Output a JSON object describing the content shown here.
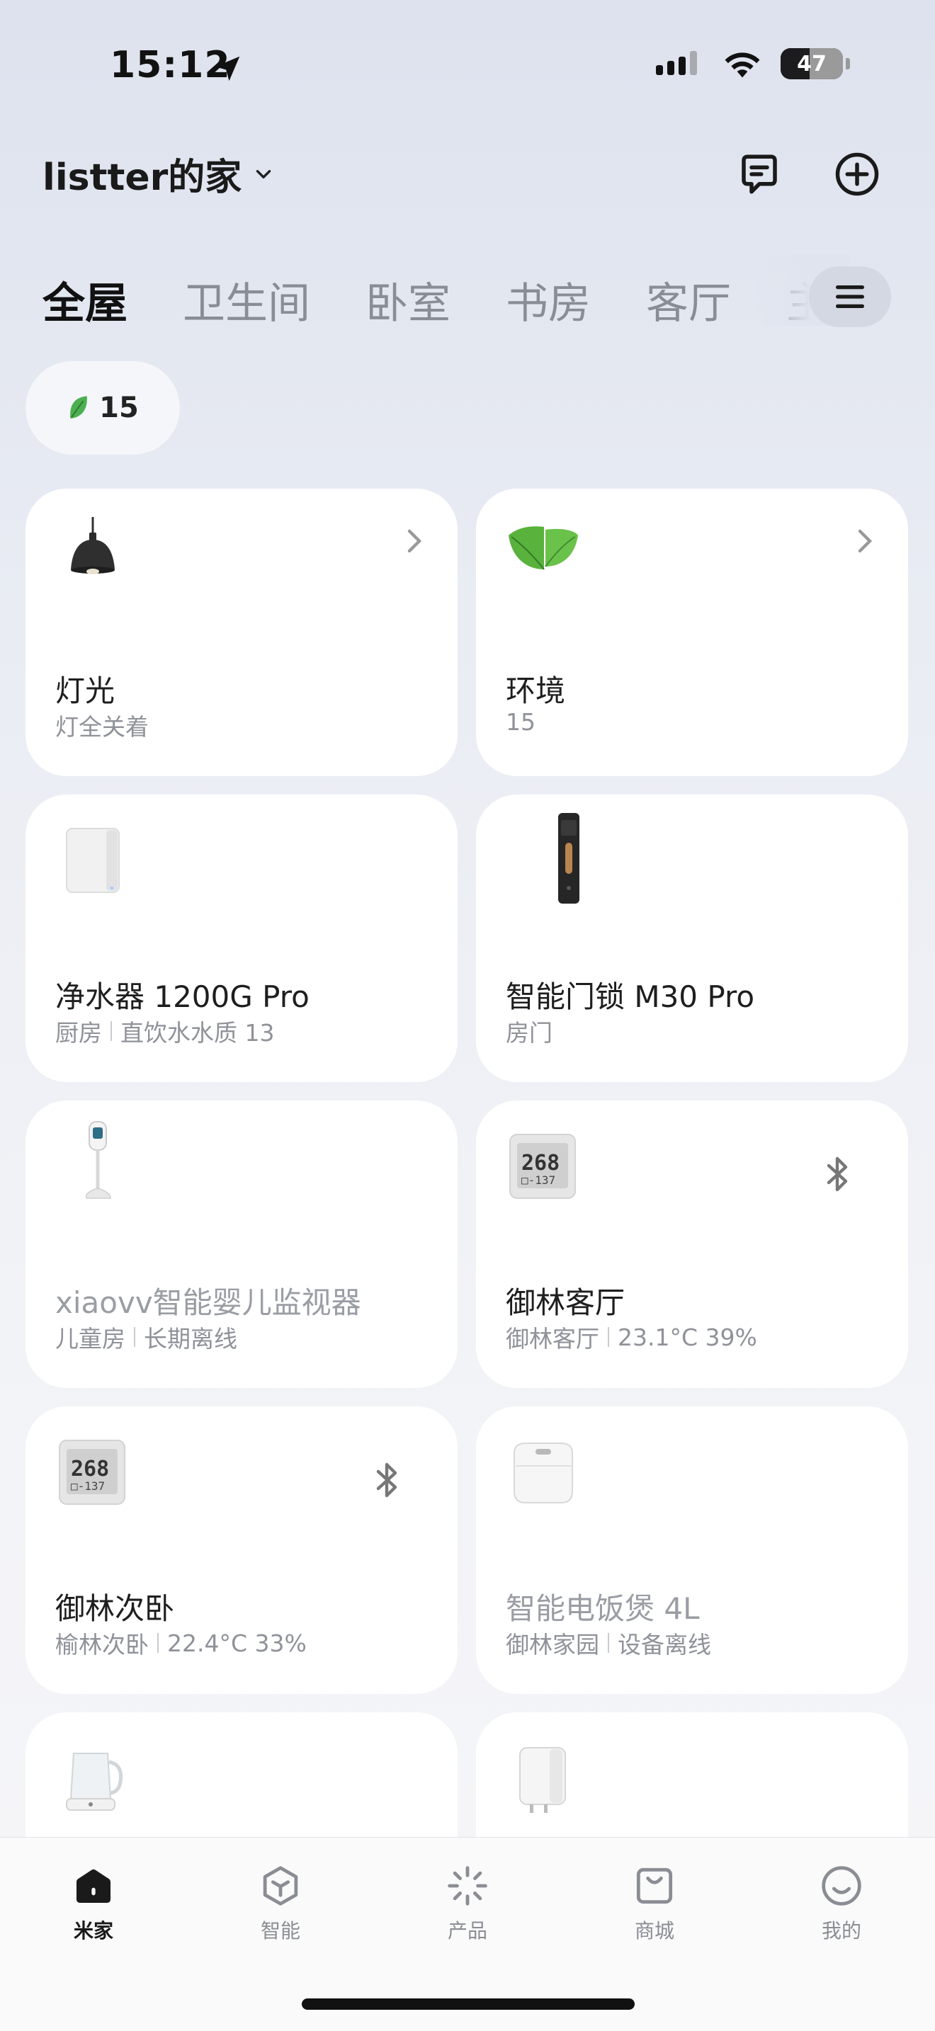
{
  "status_bar": {
    "time": "15:12",
    "battery": "47"
  },
  "header": {
    "home_name": "listter的家"
  },
  "tabs": [
    "全屋",
    "卫生间",
    "卧室",
    "书房",
    "客厅",
    "主"
  ],
  "env_chip": {
    "value": "15"
  },
  "cards": [
    {
      "name": "灯光",
      "sub": [
        "灯全关着"
      ],
      "icon": "pendant-lamp-icon"
    },
    {
      "name": "环境",
      "sub": [
        "15"
      ],
      "icon": "leaf-icon"
    },
    {
      "name": "净水器 1200G Pro",
      "sub": [
        "厨房",
        "直饮水水质 13"
      ],
      "icon": "water-purifier-icon"
    },
    {
      "name": "智能门锁 M30 Pro",
      "sub": [
        "房门"
      ],
      "icon": "door-lock-icon"
    },
    {
      "name": "xiaovv智能婴儿监视器",
      "sub": [
        "儿童房",
        "长期离线"
      ],
      "icon": "baby-monitor-icon"
    },
    {
      "name": "御林客厅",
      "sub": [
        "御林客厅",
        "23.1°C 39%"
      ],
      "icon": "thermometer-hygrometer-icon"
    },
    {
      "name": "御林次卧",
      "sub": [
        "榆林次卧",
        "22.4°C 33%"
      ],
      "icon": "thermometer-hygrometer-icon"
    },
    {
      "name": "智能电饭煲 4L",
      "sub": [
        "御林家园",
        "设备离线"
      ],
      "icon": "rice-cooker-icon"
    },
    {
      "name": "",
      "sub": [],
      "icon": "kettle-icon"
    },
    {
      "name": "",
      "sub": [],
      "icon": "smart-plug-icon"
    }
  ],
  "bottom_nav": [
    {
      "label": "米家",
      "icon": "home-icon"
    },
    {
      "label": "智能",
      "icon": "smart-icon"
    },
    {
      "label": "产品",
      "icon": "product-icon"
    },
    {
      "label": "商城",
      "icon": "store-icon"
    },
    {
      "label": "我的",
      "icon": "profile-icon"
    }
  ],
  "colors": {
    "accent": "#111111",
    "offline_text": "#9a9da4",
    "secondary_text": "#8f9299",
    "leaf_green": "#4caf50"
  }
}
